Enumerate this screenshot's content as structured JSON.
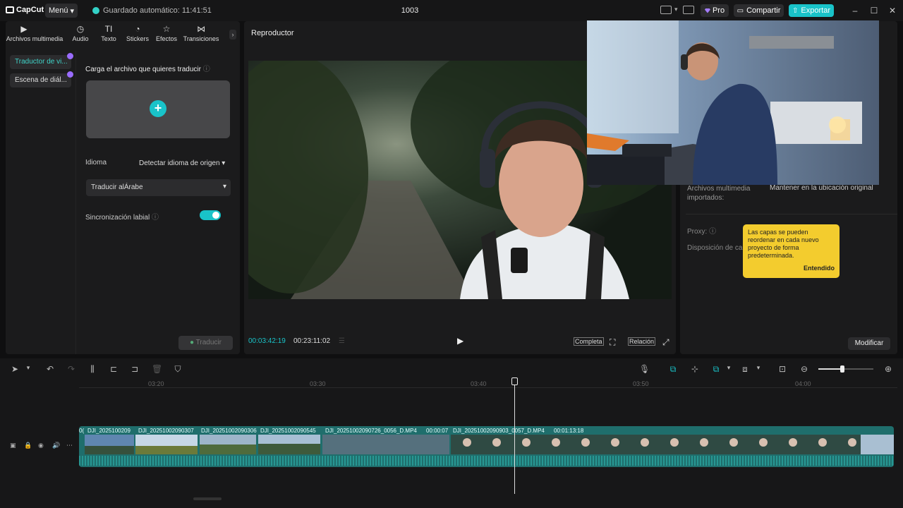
{
  "app": {
    "logo": "CapCut",
    "menu_label": "Menú",
    "autosave": "Guardado automático: 11:41:51",
    "project_title": "1003",
    "pro_label": "Pro",
    "share_label": "Compartir",
    "export_label": "Exportar"
  },
  "tool_tabs": [
    {
      "label": "Archivos multimedia",
      "icon": "media-icon"
    },
    {
      "label": "Audio",
      "icon": "audio-icon"
    },
    {
      "label": "Texto",
      "icon": "text-icon"
    },
    {
      "label": "Stickers",
      "icon": "sticker-icon"
    },
    {
      "label": "Efectos",
      "icon": "effects-icon"
    },
    {
      "label": "Transiciones",
      "icon": "transitions-icon"
    }
  ],
  "side_items": [
    "Traductor de vi...",
    "Escena de diál..."
  ],
  "translator": {
    "upload_title": "Carga el archivo que quieres traducir",
    "language_label": "Idioma",
    "language_value": "Detectar idioma de origen",
    "translate_to": "Traducir alÁrabe",
    "lipsync_label": "Sincronización labial",
    "lipsync_on": true,
    "translate_btn": "Traducir"
  },
  "player": {
    "title": "Reproductor",
    "current_time": "00:03:42:19",
    "total_time": "00:23:11:02",
    "full_label": "Completa",
    "ratio_label": "Relación"
  },
  "details": {
    "imported_label": "Archivos multimedia importados:",
    "imported_value": "Mantener en la ubicación original",
    "proxy_label": "Proxy:",
    "layout_label": "Disposición de ca",
    "modify_btn": "Modificar"
  },
  "tooltip": {
    "text": "Las capas se pueden reordenar en cada nuevo proyecto de forma predeterminada.",
    "ok": "Entendido"
  },
  "timeline": {
    "ticks": [
      "03:20",
      "03:30",
      "03:40",
      "03:50",
      "04:00"
    ],
    "clips": [
      "0(",
      "DJI_2025100209",
      "DJI_20251002090307",
      "DJI_20251002090306",
      "DJI_20251002090545",
      "DJI_20251002090726_0056_D.MP4",
      "00:00:07",
      "DJI_20251002090903_0057_D.MP4",
      "00:01:13:18"
    ]
  },
  "colors": {
    "accent": "#19c3c9",
    "tooltip": "#f3cc2e",
    "track": "#1f6e6c"
  }
}
